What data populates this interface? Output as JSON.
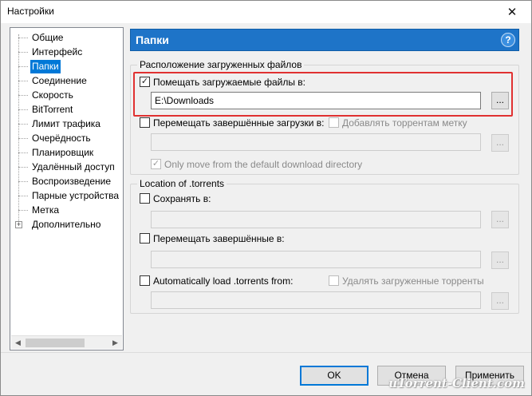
{
  "window": {
    "title": "Настройки",
    "close_glyph": "✕"
  },
  "sidebar": {
    "items": [
      {
        "label": "Общие"
      },
      {
        "label": "Интерфейс"
      },
      {
        "label": "Папки"
      },
      {
        "label": "Соединение"
      },
      {
        "label": "Скорость"
      },
      {
        "label": "BitTorrent"
      },
      {
        "label": "Лимит трафика"
      },
      {
        "label": "Очерёдность"
      },
      {
        "label": "Планировщик"
      },
      {
        "label": "Удалённый доступ"
      },
      {
        "label": "Воспроизведение"
      },
      {
        "label": "Парные устройства"
      },
      {
        "label": "Метка"
      },
      {
        "label": "Дополнительно"
      }
    ],
    "selected_index": 2,
    "expand_glyph": "+"
  },
  "header": {
    "title": "Папки",
    "help_glyph": "?"
  },
  "downloads_group": {
    "title": "Расположение загруженных файлов",
    "put_new": {
      "label": "Помещать загружаемые файлы в:",
      "checked": true,
      "path": "E:\\Downloads"
    },
    "move_completed": {
      "label": "Перемещать завершённые загрузки в:",
      "checked": false,
      "path": ""
    },
    "append_label": {
      "label": "Добавлять торрентам метку",
      "checked": false
    },
    "only_move_default": {
      "label": "Only move from the default download directory",
      "checked": true
    },
    "browse_glyph": "..."
  },
  "torrents_group": {
    "title": "Location of .torrents",
    "store_in": {
      "label": "Сохранять в:",
      "checked": false,
      "path": ""
    },
    "move_completed": {
      "label": "Перемещать завершённые в:",
      "checked": false,
      "path": ""
    },
    "autoload": {
      "label": "Automatically load .torrents from:",
      "checked": false,
      "path": ""
    },
    "delete_loaded": {
      "label": "Удалять загруженные торренты",
      "checked": false
    }
  },
  "buttons": {
    "ok": "OK",
    "cancel": "Отмена",
    "apply": "Применить"
  },
  "watermark": "uTorrent-Client.com",
  "colors": {
    "header": "#1e74c8",
    "selection": "#0078d7",
    "highlight": "#e03131"
  }
}
